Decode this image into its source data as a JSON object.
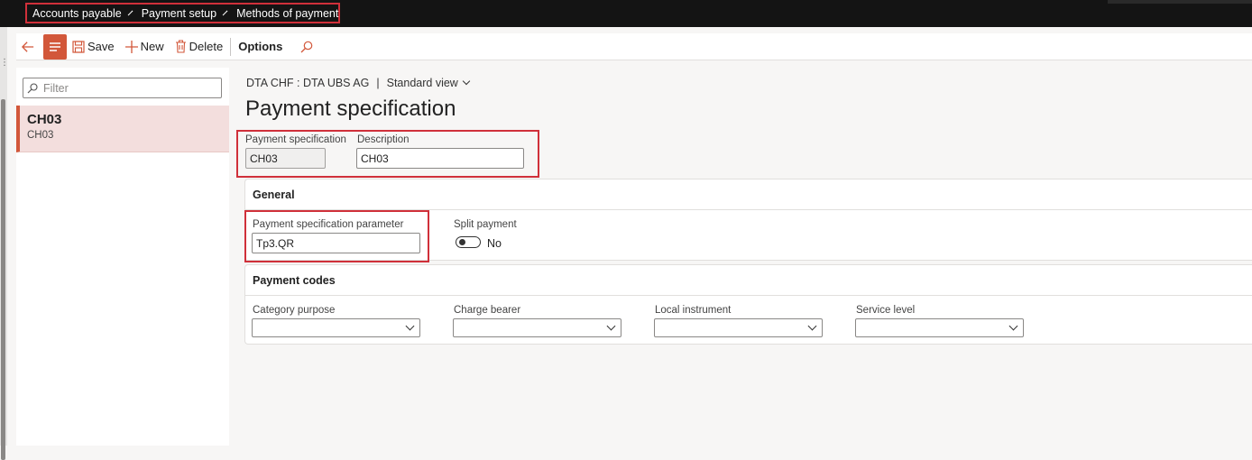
{
  "breadcrumb": {
    "items": [
      "Accounts payable",
      "Payment setup",
      "Methods of payment"
    ]
  },
  "toolbar": {
    "save_label": "Save",
    "new_label": "New",
    "delete_label": "Delete",
    "options_label": "Options"
  },
  "list": {
    "filter_placeholder": "Filter",
    "items": [
      {
        "title": "CH03",
        "subtitle": "CH03"
      }
    ]
  },
  "main": {
    "caption_record": "DTA CHF : DTA UBS AG",
    "caption_view": "Standard view",
    "title": "Payment specification",
    "fields": {
      "payment_specification_label": "Payment specification",
      "payment_specification_value": "CH03",
      "description_label": "Description",
      "description_value": "CH03"
    },
    "general": {
      "header": "General",
      "parameter_label": "Payment specification parameter",
      "parameter_value": "Tp3.QR",
      "split_payment_label": "Split payment",
      "split_payment_state": "No"
    },
    "payment_codes": {
      "header": "Payment codes",
      "category_purpose_label": "Category purpose",
      "category_purpose_value": "",
      "charge_bearer_label": "Charge bearer",
      "charge_bearer_value": "",
      "local_instrument_label": "Local instrument",
      "local_instrument_value": "",
      "service_level_label": "Service level",
      "service_level_value": ""
    }
  },
  "colors": {
    "accent": "#d2573a",
    "highlight_box": "#d0303a",
    "topbar": "#141414"
  }
}
